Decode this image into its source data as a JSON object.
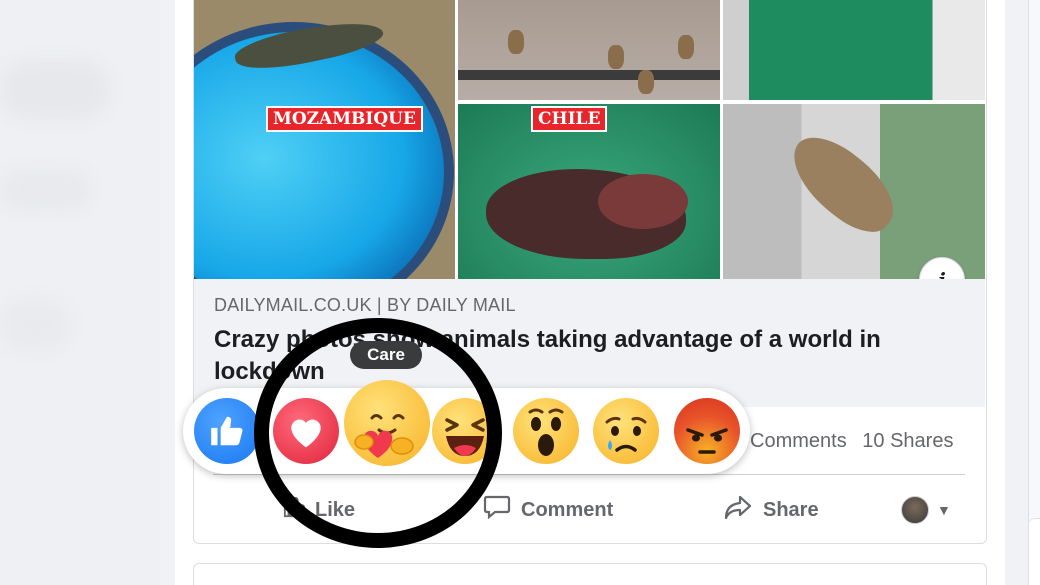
{
  "post": {
    "link_source_domain": "DAILYMAIL.CO.UK",
    "link_source_separator": "|",
    "link_source_by": "BY DAILY MAIL",
    "link_title": "Crazy photos show animals taking advantage of a world in lockdown",
    "image_tags": [
      "MOZAMBIQUE",
      "CHILE"
    ],
    "info_icon": "i"
  },
  "stats": {
    "comments": "Comments",
    "shares": "10 Shares"
  },
  "actions": {
    "like": "Like",
    "comment": "Comment",
    "share": "Share"
  },
  "reactions": {
    "tooltip": "Care",
    "items": [
      "like",
      "love",
      "care",
      "haha",
      "wow",
      "sad",
      "angry"
    ],
    "colors": {
      "like": "#1877f2",
      "love": "#e0243b",
      "yellow": "#f7b125"
    }
  },
  "annotation": {
    "shape": "black-circle",
    "color": "#000000"
  }
}
